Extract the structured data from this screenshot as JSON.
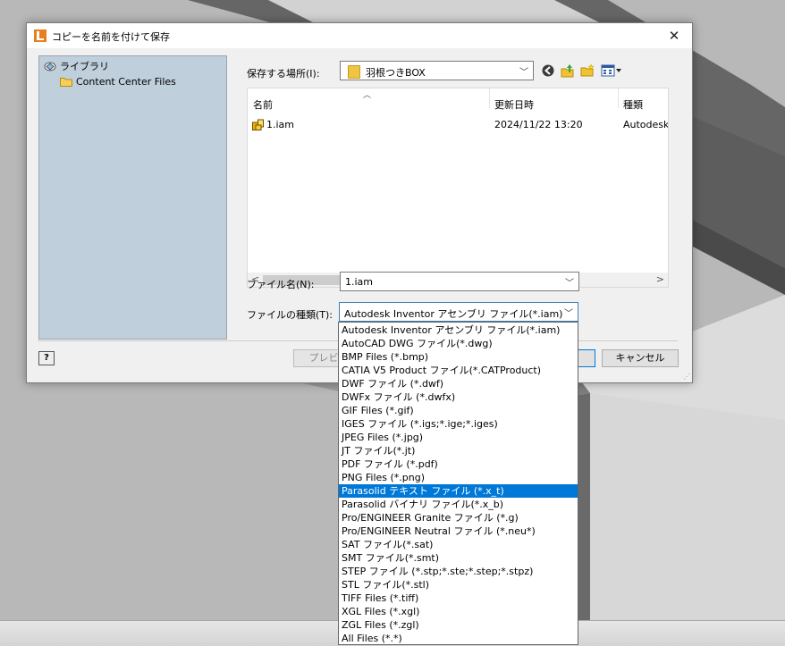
{
  "dialog": {
    "title": "コピーを名前を付けて保存",
    "close_glyph": "✕"
  },
  "places": {
    "items": [
      {
        "label": "ライブラリ",
        "icon": "library-icon"
      },
      {
        "label": "Content Center Files",
        "icon": "folder-icon"
      }
    ]
  },
  "save_in": {
    "label": "保存する場所(I):",
    "value": "羽根つきBOX",
    "toolbar": [
      "back-icon",
      "up-folder-icon",
      "new-folder-icon",
      "view-menu-icon"
    ]
  },
  "file_list": {
    "columns": [
      "名前",
      "更新日時",
      "種類"
    ],
    "rows": [
      {
        "name": "1.iam",
        "modified": "2024/11/22 13:20",
        "type": "Autodesk"
      }
    ]
  },
  "file_name": {
    "label": "ファイル名(N):",
    "value": "1.iam"
  },
  "file_type": {
    "label": "ファイルの種類(T):",
    "value": "Autodesk Inventor アセンブリ ファイル(*.iam)",
    "options": [
      "Autodesk Inventor アセンブリ ファイル(*.iam)",
      "AutoCAD DWG ファイル(*.dwg)",
      "BMP Files (*.bmp)",
      "CATIA V5 Product ファイル(*.CATProduct)",
      "DWF ファイル (*.dwf)",
      "DWFx ファイル (*.dwfx)",
      "GIF Files (*.gif)",
      "IGES ファイル (*.igs;*.ige;*.iges)",
      "JPEG Files (*.jpg)",
      "JT ファイル(*.jt)",
      "PDF ファイル (*.pdf)",
      "PNG Files (*.png)",
      "Parasolid テキスト ファイル (*.x_t)",
      "Parasolid バイナリ ファイル(*.x_b)",
      "Pro/ENGINEER Granite ファイル (*.g)",
      "Pro/ENGINEER Neutral ファイル (*.neu*)",
      "SAT ファイル(*.sat)",
      "SMT ファイル(*.smt)",
      "STEP ファイル (*.stp;*.ste;*.step;*.stpz)",
      "STL ファイル(*.stl)",
      "TIFF Files (*.tiff)",
      "XGL Files (*.xgl)",
      "ZGL Files (*.zgl)",
      "All Files (*.*)"
    ],
    "highlighted_index": 12
  },
  "buttons": {
    "help": "?",
    "preview": "プレビュー",
    "save": "",
    "cancel": "キャンセル"
  },
  "colors": {
    "accent": "#0078d7",
    "places_bg": "#c0cfdc",
    "viewport_bg": "#b9b9b9"
  }
}
